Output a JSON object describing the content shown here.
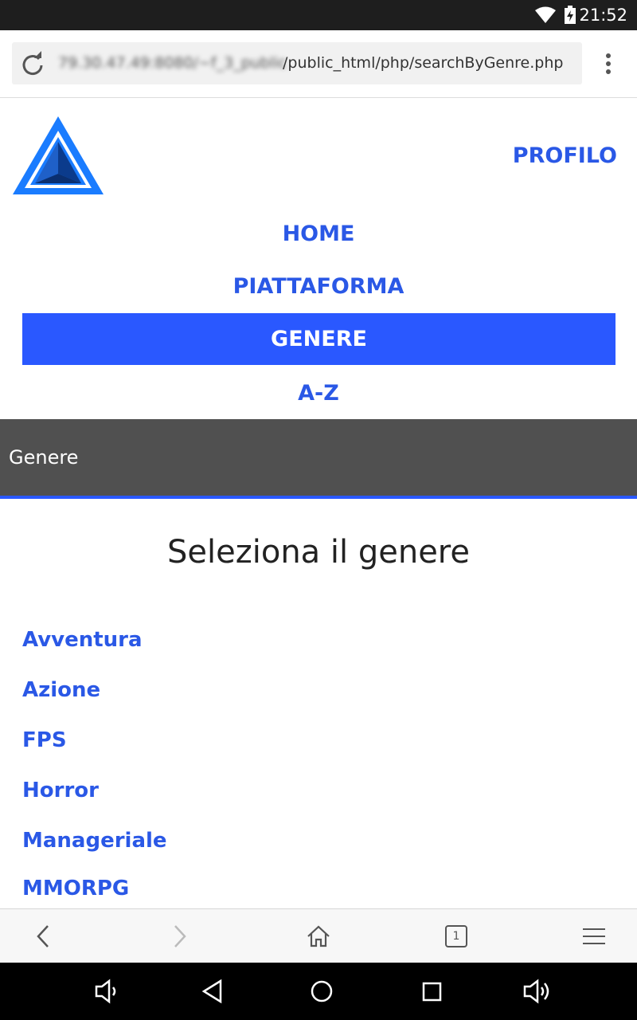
{
  "status_bar": {
    "time": "21:52"
  },
  "browser": {
    "url_host": "79.30.47.49:8080/~f_3_public",
    "url_path": "/public_html/php/searchByGenre.php",
    "tab_count": "1"
  },
  "nav": {
    "profilo": "PROFILO",
    "home": "HOME",
    "piattaforma": "PIATTAFORMA",
    "genere": "GENERE",
    "az": "A-Z"
  },
  "section_title": "Genere",
  "heading": "Seleziona il genere",
  "genres": [
    "Avventura",
    "Azione",
    "FPS",
    "Horror",
    "Manageriale",
    "MMORPG"
  ],
  "colors": {
    "accent": "#2a58ff",
    "link": "#2a58e6",
    "section_bg": "#505050"
  }
}
